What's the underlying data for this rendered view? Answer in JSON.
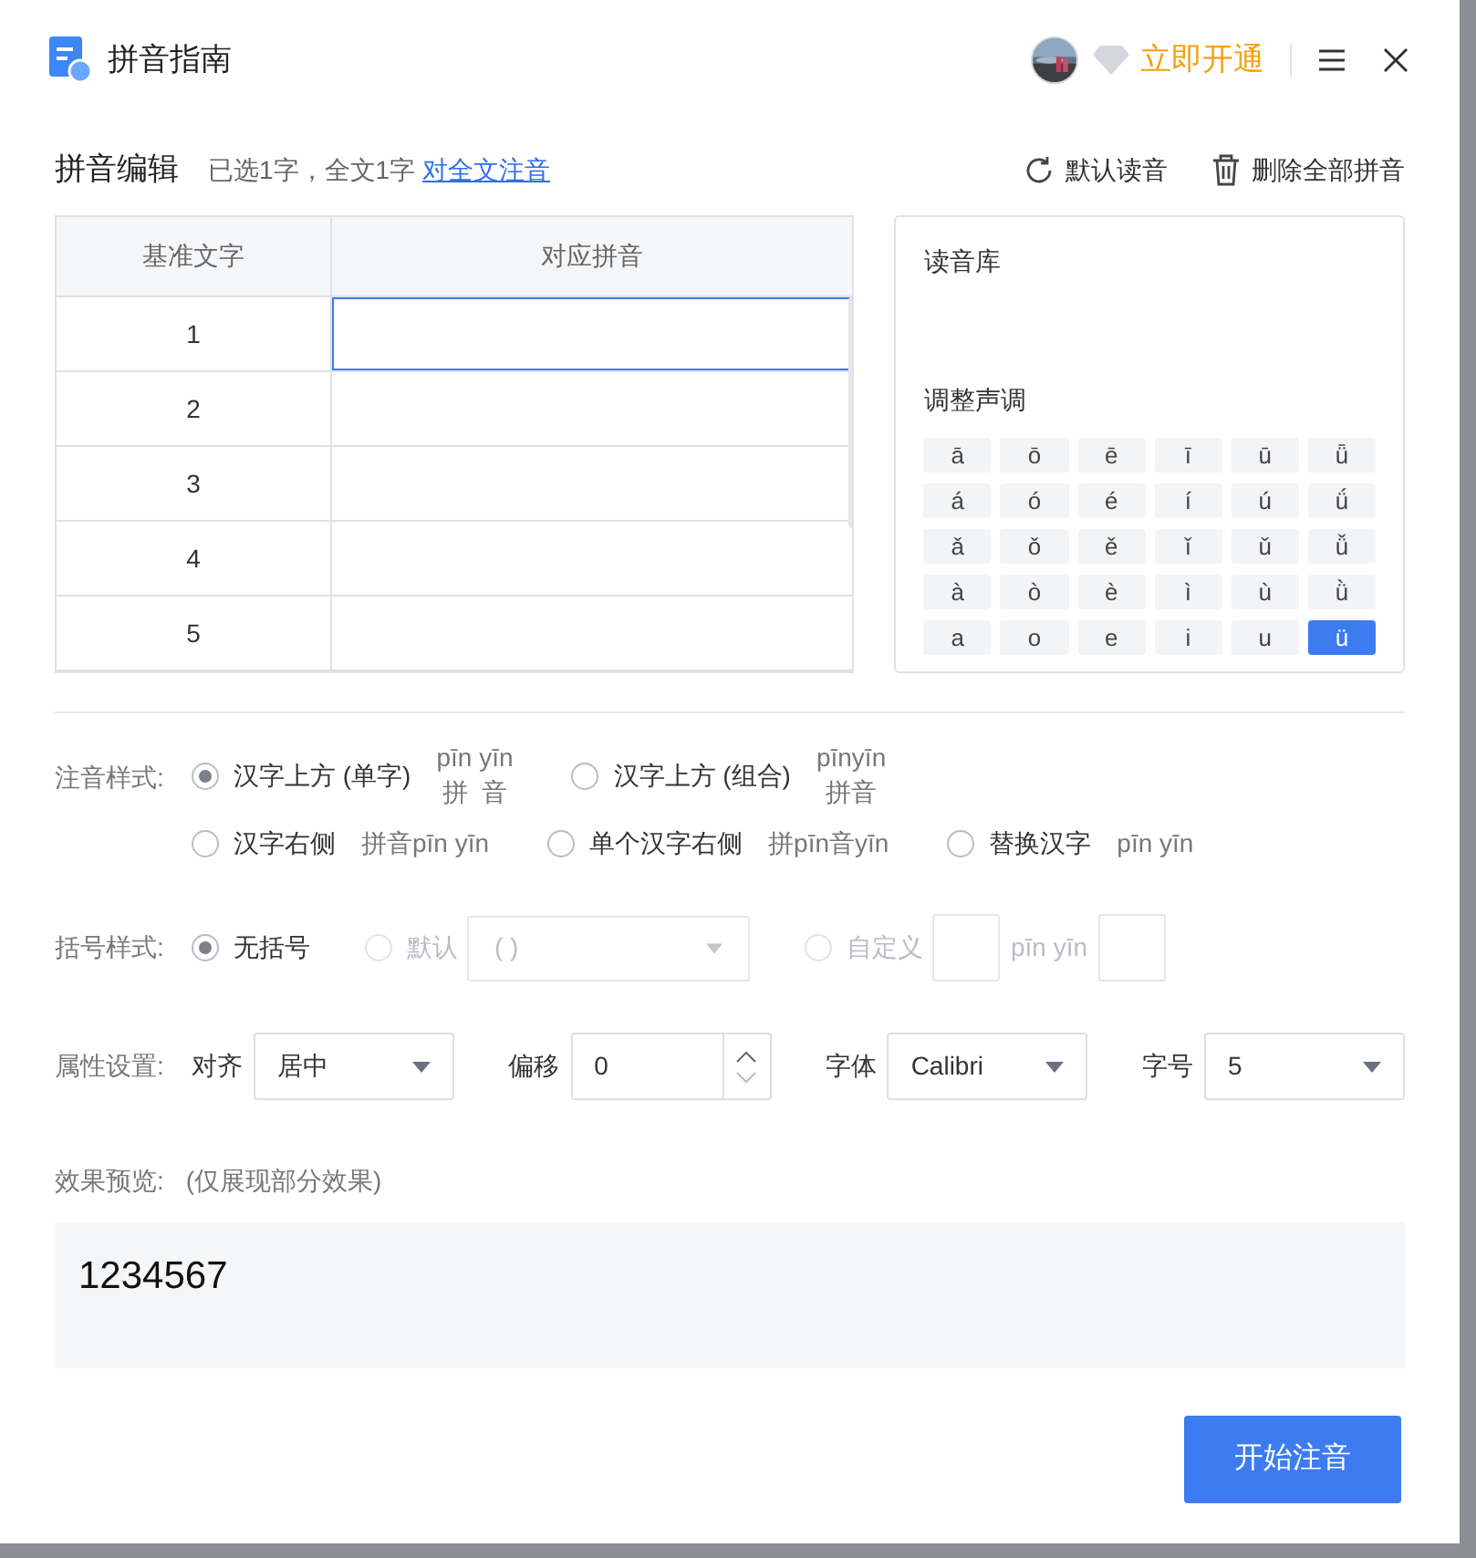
{
  "header": {
    "title": "拼音指南",
    "vip_link": "立即开通"
  },
  "editor": {
    "heading": "拼音编辑",
    "info": "已选1字，全文1字",
    "link": "对全文注音",
    "actions": [
      {
        "kind": "reset",
        "label": "默认读音"
      },
      {
        "kind": "delete",
        "label": "删除全部拼音"
      }
    ]
  },
  "table": {
    "columns": [
      "基准文字",
      "对应拼音"
    ],
    "rows": [
      {
        "base": "1",
        "selected": true
      },
      {
        "base": "2",
        "selected": false
      },
      {
        "base": "3",
        "selected": false
      },
      {
        "base": "4",
        "selected": false
      },
      {
        "base": "5",
        "selected": false
      }
    ]
  },
  "tone_panel": {
    "library_title": "读音库",
    "tone_title": "调整声调",
    "tones": [
      {
        "label": "ā",
        "selected": false
      },
      {
        "label": "ō",
        "selected": false
      },
      {
        "label": "ē",
        "selected": false
      },
      {
        "label": "ī",
        "selected": false
      },
      {
        "label": "ū",
        "selected": false
      },
      {
        "label": "ǖ",
        "selected": false
      },
      {
        "label": "á",
        "selected": false
      },
      {
        "label": "ó",
        "selected": false
      },
      {
        "label": "é",
        "selected": false
      },
      {
        "label": "í",
        "selected": false
      },
      {
        "label": "ú",
        "selected": false
      },
      {
        "label": "ǘ",
        "selected": false
      },
      {
        "label": "ǎ",
        "selected": false
      },
      {
        "label": "ǒ",
        "selected": false
      },
      {
        "label": "ě",
        "selected": false
      },
      {
        "label": "ǐ",
        "selected": false
      },
      {
        "label": "ǔ",
        "selected": false
      },
      {
        "label": "ǚ",
        "selected": false
      },
      {
        "label": "à",
        "selected": false
      },
      {
        "label": "ò",
        "selected": false
      },
      {
        "label": "è",
        "selected": false
      },
      {
        "label": "ì",
        "selected": false
      },
      {
        "label": "ù",
        "selected": false
      },
      {
        "label": "ǜ",
        "selected": false
      },
      {
        "label": "a",
        "selected": false
      },
      {
        "label": "o",
        "selected": false
      },
      {
        "label": "e",
        "selected": false
      },
      {
        "label": "i",
        "selected": false
      },
      {
        "label": "u",
        "selected": false
      },
      {
        "label": "ü",
        "selected": true
      }
    ]
  },
  "annotation_style": {
    "label": "注音样式:",
    "options": [
      {
        "label": "汉字上方 (单字)",
        "sample": [
          "pīn yīn",
          "拼  音"
        ],
        "selected": true
      },
      {
        "label": "汉字上方 (组合)",
        "sample": [
          "pīnyīn",
          "拼音"
        ],
        "selected": false
      },
      {
        "label": "汉字右侧",
        "sample": [
          "拼音pīn yīn"
        ],
        "selected": false
      },
      {
        "label": "单个汉字右侧",
        "sample": [
          "拼pīn音yīn"
        ],
        "selected": false
      },
      {
        "label": "替换汉字",
        "sample": [
          "pīn yīn"
        ],
        "selected": false
      }
    ]
  },
  "bracket_style": {
    "label": "括号样式:",
    "options": [
      {
        "kind": "plain",
        "label": "无括号",
        "selected": true,
        "disabled": false
      },
      {
        "kind": "dropdown",
        "label": "默认",
        "value": "( )",
        "selected": false,
        "disabled": true
      },
      {
        "kind": "custom",
        "label": "自定义",
        "sample": "pīn yīn",
        "selected": false,
        "disabled": true
      }
    ]
  },
  "properties": {
    "label": "属性设置:",
    "fields": [
      {
        "kind": "select",
        "label": "对齐",
        "value": "居中"
      },
      {
        "kind": "spinner",
        "label": "偏移",
        "value": "0"
      },
      {
        "kind": "select",
        "label": "字体",
        "value": "Calibri"
      },
      {
        "kind": "select",
        "label": "字号",
        "value": "5"
      }
    ]
  },
  "preview": {
    "label": "效果预览:",
    "note": "(仅展现部分效果)",
    "text": "1234567"
  },
  "start_button": "开始注音"
}
